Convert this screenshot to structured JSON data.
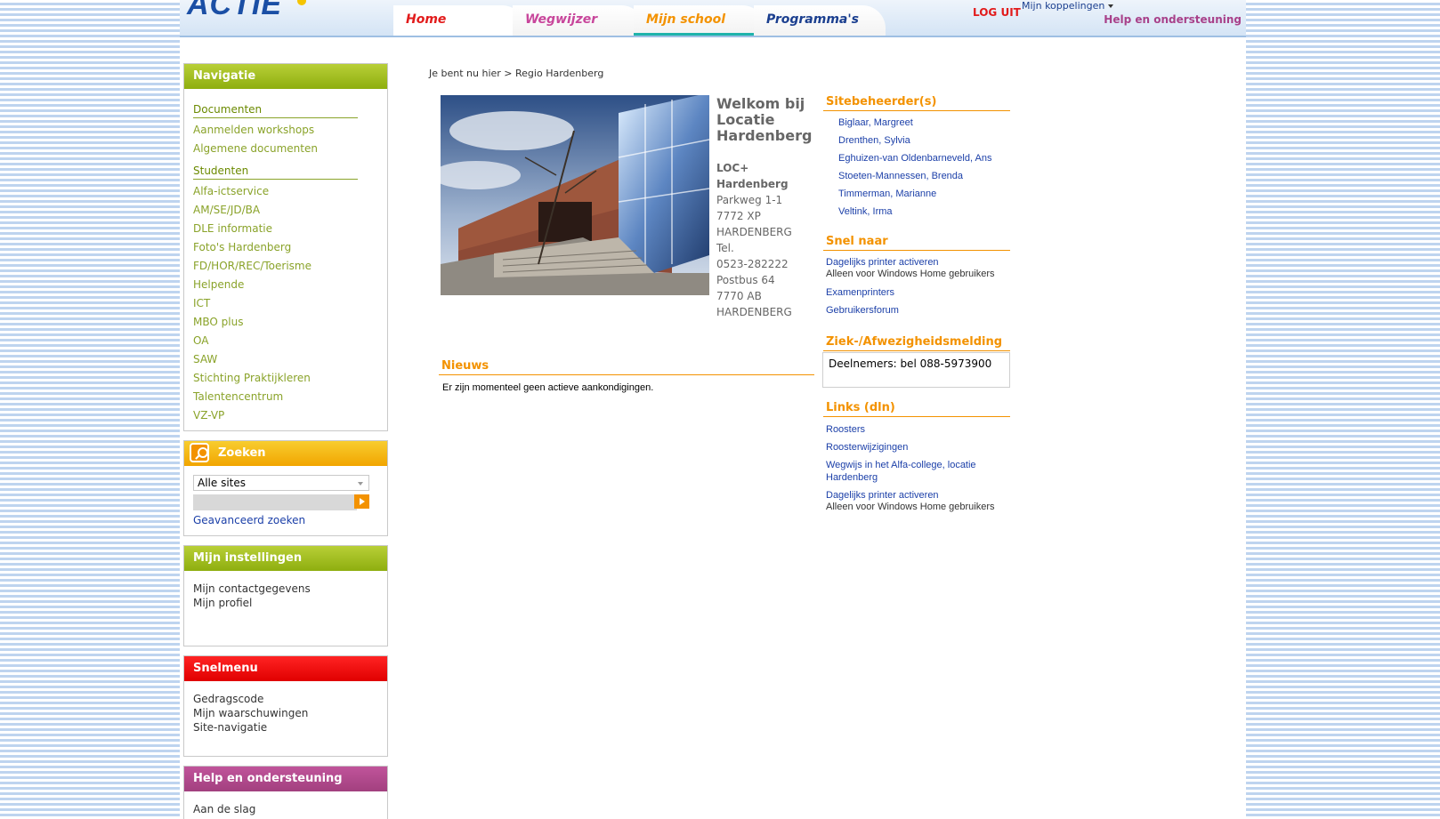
{
  "header": {
    "logo": "ACTIE",
    "tabs": [
      {
        "label": "Home"
      },
      {
        "label": "Wegwijzer"
      },
      {
        "label": "Mijn school"
      },
      {
        "label": "Programma's"
      }
    ],
    "logout": "LOG UIT",
    "koppelingen": "Mijn koppelingen",
    "help": "Help en ondersteuning"
  },
  "nav": {
    "title": "Navigatie",
    "groups": [
      {
        "label": "Documenten",
        "items": [
          "Aanmelden workshops",
          "Algemene documenten"
        ]
      },
      {
        "label": "Studenten",
        "items": [
          "Alfa-ictservice",
          "AM/SE/JD/BA",
          "DLE informatie",
          "Foto's Hardenberg",
          "FD/HOR/REC/Toerisme",
          "Helpende",
          "ICT",
          "MBO plus",
          "OA",
          "SAW",
          "Stichting Praktijkleren",
          "Talentencentrum",
          "VZ-VP"
        ]
      }
    ]
  },
  "search": {
    "title": "Zoeken",
    "scope": "Alle sites",
    "advanced": "Geavanceerd zoeken"
  },
  "settings": {
    "title": "Mijn instellingen",
    "items": [
      "Mijn contactgegevens",
      "Mijn profiel"
    ]
  },
  "snelmenu": {
    "title": "Snelmenu",
    "items": [
      "Gedragscode",
      "Mijn waarschuwingen",
      "Site-navigatie"
    ]
  },
  "helpbox": {
    "title": "Help en ondersteuning",
    "items": [
      "Aan de slag"
    ]
  },
  "main": {
    "breadcrumb": "Je bent nu hier > Regio Hardenberg",
    "welcome": "Welkom bij Locatie Hardenberg",
    "address": {
      "name": "LOC+ Hardenberg",
      "street": "Parkweg 1-1",
      "zip": "7772 XP",
      "city": "HARDENBERG",
      "tel_label": "Tel.",
      "tel": "0523-282222",
      "po": "Postbus 64",
      "po_zip": "7770 AB",
      "po_city": "HARDENBERG"
    },
    "news_title": "Nieuws",
    "news_text": "Er zijn momenteel geen actieve aankondigingen."
  },
  "right": {
    "admins_title": "Sitebeheerder(s)",
    "admins": [
      "Biglaar, Margreet",
      "Drenthen, Sylvia",
      "Eghuizen-van Oldenbarneveld, Ans",
      "Stoeten-Mannessen, Brenda",
      "Timmerman, Marianne",
      "Veltink, Irma"
    ],
    "snel_title": "Snel naar",
    "snel": [
      {
        "label": "Dagelijks printer activeren",
        "note": "Alleen voor Windows Home gebruikers"
      },
      {
        "label": "Examenprinters"
      },
      {
        "label": "Gebruikersforum"
      }
    ],
    "ziek_title": "Ziek-/Afwezigheidsmelding",
    "ziek_text": "Deelnemers: bel 088-5973900",
    "links_title": "Links (dln)",
    "links": [
      {
        "label": "Roosters"
      },
      {
        "label": "Roosterwijzigingen"
      },
      {
        "label": "Wegwijs in het Alfa-college, locatie Hardenberg"
      },
      {
        "label": "Dagelijks printer activeren",
        "note": "Alleen voor Windows Home gebruikers"
      }
    ]
  },
  "colors": {
    "green": "#8eae0f",
    "orange": "#f39200",
    "red": "#e00000",
    "purple": "#a2407f",
    "link_blue": "#1b3fa8"
  }
}
